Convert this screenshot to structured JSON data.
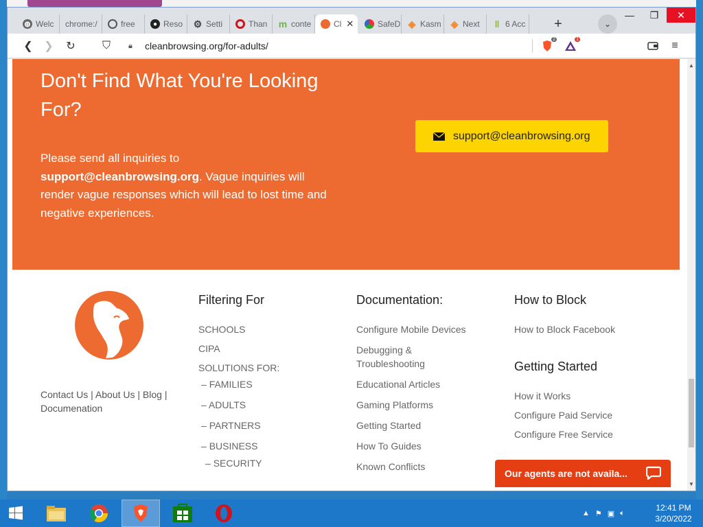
{
  "browser": {
    "tabs": [
      {
        "label": "Welc",
        "icon": "globe-icon"
      },
      {
        "label": "chrome:/",
        "icon": "none"
      },
      {
        "label": "free",
        "icon": "search-icon"
      },
      {
        "label": "Reso",
        "icon": "github-icon"
      },
      {
        "label": "Setti",
        "icon": "gear-icon"
      },
      {
        "label": "Than",
        "icon": "opera-icon"
      },
      {
        "label": "conte",
        "icon": "m-icon"
      },
      {
        "label": "Cl",
        "icon": "cleanbrowsing-icon"
      },
      {
        "label": "SafeD",
        "icon": "shield-icon"
      },
      {
        "label": "Kasm",
        "icon": "kasm-icon"
      },
      {
        "label": "Next",
        "icon": "kasm-icon"
      },
      {
        "label": "6 Acc",
        "icon": "leaf-icon"
      }
    ],
    "url": "cleanbrowsing.org/for-adults/",
    "brave_shield_count": "2",
    "brave_rewards_count": "1"
  },
  "contact": {
    "heading": "Don't Find What You're Looking For?",
    "body_prefix": "Please send all inquiries to ",
    "body_email": "support@cleanbrowsing.org",
    "body_suffix": ". Vague inquiries will render vague responses which will lead to lost time and negative experiences.",
    "button_label": "support@cleanbrowsing.org"
  },
  "footer": {
    "links": [
      "Contact Us",
      "About Us",
      "Blog",
      "Documenation"
    ],
    "filtering": {
      "heading": "Filtering For",
      "items": [
        "SCHOOLS",
        "CIPA",
        "SOLUTIONS FOR:"
      ],
      "solutions": [
        "FAMILIES",
        "ADULTS",
        "PARTNERS",
        "BUSINESS",
        "SECURITY"
      ]
    },
    "documentation": {
      "heading": "Documentation:",
      "items": [
        "Configure Mobile Devices",
        "Debugging & Troubleshooting",
        "Educational Articles",
        "Gaming Platforms",
        "Getting Started",
        "How To Guides",
        "Known Conflicts"
      ]
    },
    "how_to_block": {
      "heading": "How to Block",
      "items": [
        "How to Block Facebook"
      ]
    },
    "getting_started": {
      "heading": "Getting Started",
      "items": [
        "How it Works",
        "Configure Paid Service",
        "Configure Free Service"
      ]
    }
  },
  "chat": {
    "label": "Our agents are not availa..."
  },
  "taskbar": {
    "time": "12:41 PM",
    "date": "3/20/2022"
  },
  "colors": {
    "brand_orange": "#ed6b30",
    "button_yellow": "#fdd300",
    "chat_red": "#e53e13",
    "taskbar_blue": "#1e78c9"
  }
}
